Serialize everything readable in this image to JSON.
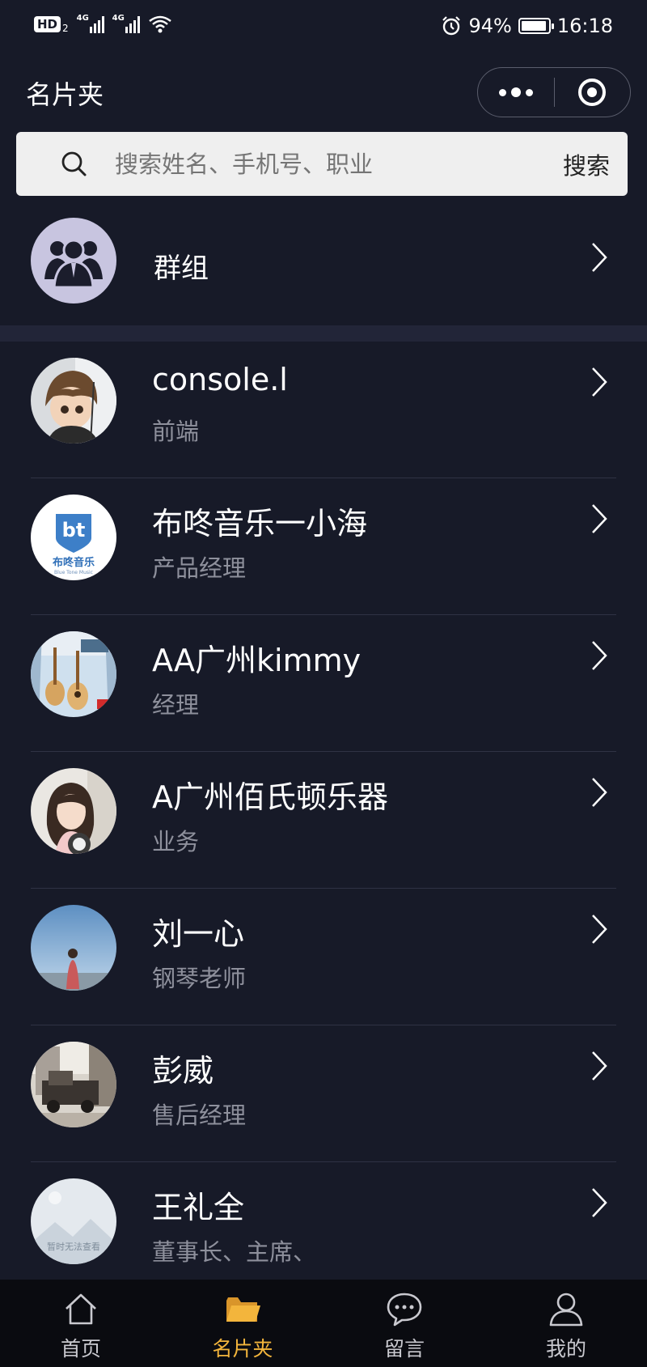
{
  "status_bar": {
    "hd": "HD",
    "hd_sub": "2",
    "net1": "4G",
    "net2": "4G",
    "battery": "94%",
    "battery_level": 0.94,
    "time": "16:18"
  },
  "header": {
    "title": "名片夹",
    "more_icon": "more-dots-icon",
    "close_icon": "target-icon"
  },
  "search": {
    "placeholder": "搜索姓名、手机号、职业",
    "button": "搜索"
  },
  "group": {
    "label": "群组"
  },
  "contacts": [
    {
      "name": "console.l",
      "title": "前端"
    },
    {
      "name": "布咚音乐一小海",
      "title": "产品经理",
      "logo_text": "布咚音乐",
      "logo_sub": "Blue Tone Music",
      "logo_mark": "bt"
    },
    {
      "name": "AA广州kimmy",
      "title": "经理"
    },
    {
      "name": "A广州佰氏顿乐器",
      "title": "业务"
    },
    {
      "name": "刘一心",
      "title": "钢琴老师"
    },
    {
      "name": "彭威",
      "title": "售后经理"
    },
    {
      "name": "王礼全",
      "title": "董事长、主席、",
      "avatar_text": "暂时无法查看"
    }
  ],
  "tabs": [
    {
      "label": "首页",
      "icon": "home-icon"
    },
    {
      "label": "名片夹",
      "icon": "folder-icon",
      "active": true
    },
    {
      "label": "留言",
      "icon": "chat-bubble-icon"
    },
    {
      "label": "我的",
      "icon": "user-icon"
    }
  ],
  "colors": {
    "background": "#171a28",
    "accent": "#f3b53c",
    "tabbar": "#0a0b10"
  }
}
